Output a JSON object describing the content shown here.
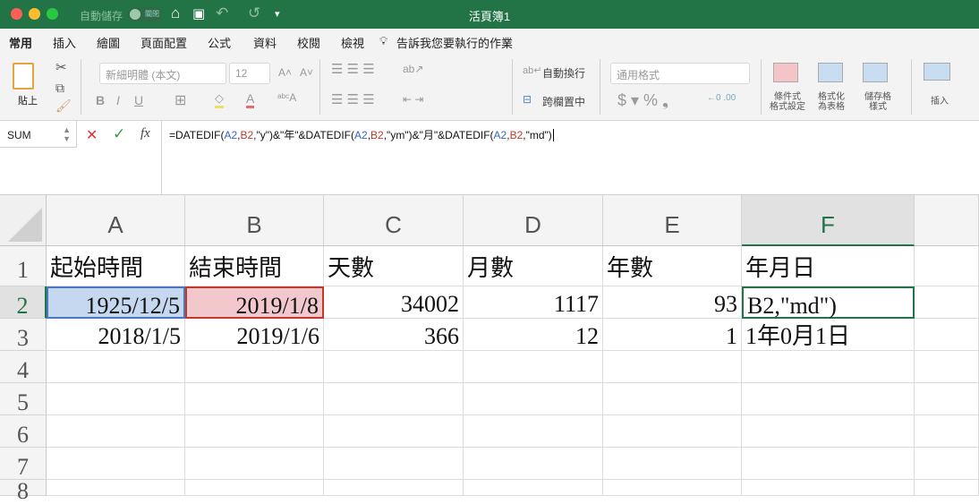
{
  "titlebar": {
    "autosave_label": "自動儲存",
    "autosave_state": "關閉",
    "title": "活頁簿1"
  },
  "tabs": [
    "常用",
    "插入",
    "繪圖",
    "頁面配置",
    "公式",
    "資料",
    "校閱",
    "檢視"
  ],
  "tell_me": "告訴我您要執行的作業",
  "ribbon": {
    "paste": "貼上",
    "font_name": "新細明體 (本文)",
    "font_size": "12",
    "wrap_text": "自動換行",
    "merge_center": "跨欄置中",
    "number_format": "通用格式",
    "conditional_format": [
      "條件式",
      "格式設定"
    ],
    "format_table": [
      "格式化",
      "為表格"
    ],
    "cell_styles": [
      "儲存格",
      "樣式"
    ],
    "insert": "插入"
  },
  "formula_bar": {
    "name_box": "SUM",
    "fx": "fx",
    "formula_parts": [
      {
        "t": "=DATEDIF(",
        "c": "#111"
      },
      {
        "t": "A2",
        "c": "#3465c4"
      },
      {
        "t": ",",
        "c": "#111"
      },
      {
        "t": "B2",
        "c": "#c0392b"
      },
      {
        "t": ",\"y\")&\"年\"&DATEDIF(",
        "c": "#111"
      },
      {
        "t": "A2",
        "c": "#3465c4"
      },
      {
        "t": ",",
        "c": "#111"
      },
      {
        "t": "B2",
        "c": "#c0392b"
      },
      {
        "t": ",\"ym\")&\"月\"&DATEDIF(",
        "c": "#111"
      },
      {
        "t": "A2",
        "c": "#3465c4"
      },
      {
        "t": ",",
        "c": "#111"
      },
      {
        "t": "B2",
        "c": "#c0392b"
      },
      {
        "t": ",\"md\")",
        "c": "#111"
      }
    ]
  },
  "columns": [
    "A",
    "B",
    "C",
    "D",
    "E",
    "F"
  ],
  "rows": [
    "1",
    "2",
    "3",
    "4",
    "5",
    "6",
    "7",
    "8"
  ],
  "cells": [
    [
      "起始時間",
      "結束時間",
      "天數",
      "月數",
      "年數",
      "年月日"
    ],
    [
      "1925/12/5",
      "2019/1/8",
      "34002",
      "1117",
      "93",
      "B2,\"md\")"
    ],
    [
      "2018/1/5",
      "2019/1/6",
      "366",
      "12",
      "1",
      "1年0月1日"
    ]
  ],
  "colors": {
    "accent": "#227447",
    "ref_a2": "#3465c4",
    "ref_b2": "#c0392b"
  }
}
